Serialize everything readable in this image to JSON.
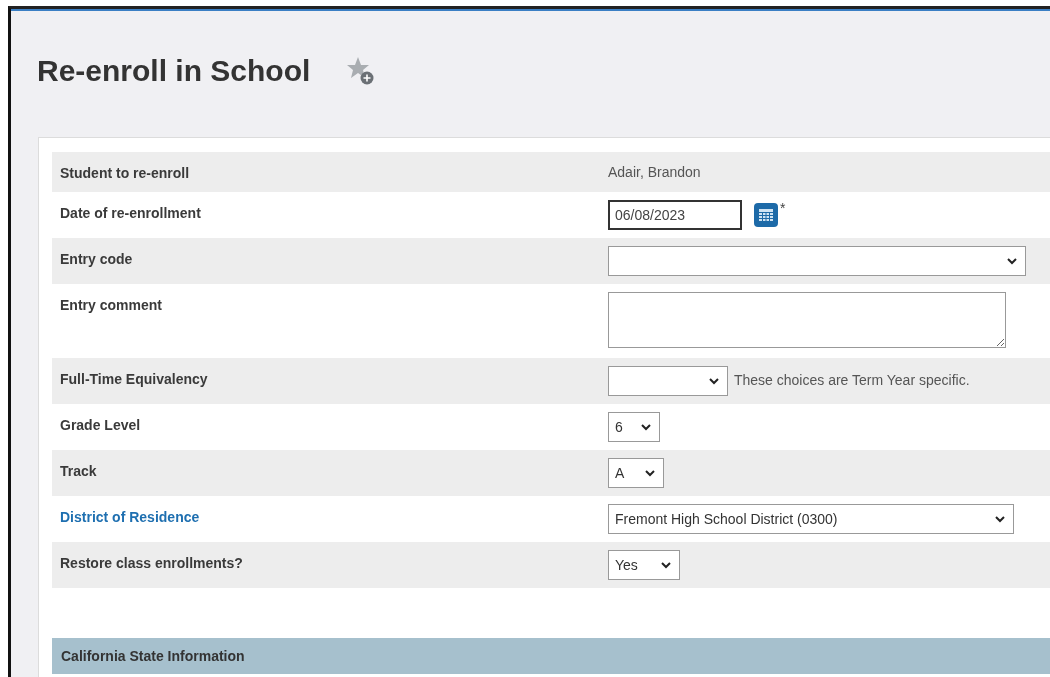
{
  "page": {
    "title": "Re-enroll in School"
  },
  "rows": [
    {
      "label": "Student to re-enroll",
      "link": false,
      "kind": "text",
      "value": "Adair, Brandon"
    },
    {
      "label": "Date of re-enrollment",
      "link": false,
      "kind": "date",
      "value": "06/08/2023",
      "required_mark": "*"
    },
    {
      "label": "Entry code",
      "link": false,
      "kind": "select",
      "value": ""
    },
    {
      "label": "Entry comment",
      "link": false,
      "kind": "textarea",
      "value": ""
    },
    {
      "label": "Full-Time Equivalency",
      "link": false,
      "kind": "select",
      "value": "",
      "note": "These choices are Term Year specific."
    },
    {
      "label": "Grade Level",
      "link": false,
      "kind": "select",
      "value": "6"
    },
    {
      "label": "Track",
      "link": false,
      "kind": "select",
      "value": "A"
    },
    {
      "label": "District of Residence",
      "link": true,
      "kind": "select",
      "value": "Fremont High School District (0300)"
    },
    {
      "label": "Restore class enrollments?",
      "link": false,
      "kind": "select",
      "value": "Yes"
    }
  ],
  "section": {
    "title": "California State Information"
  }
}
